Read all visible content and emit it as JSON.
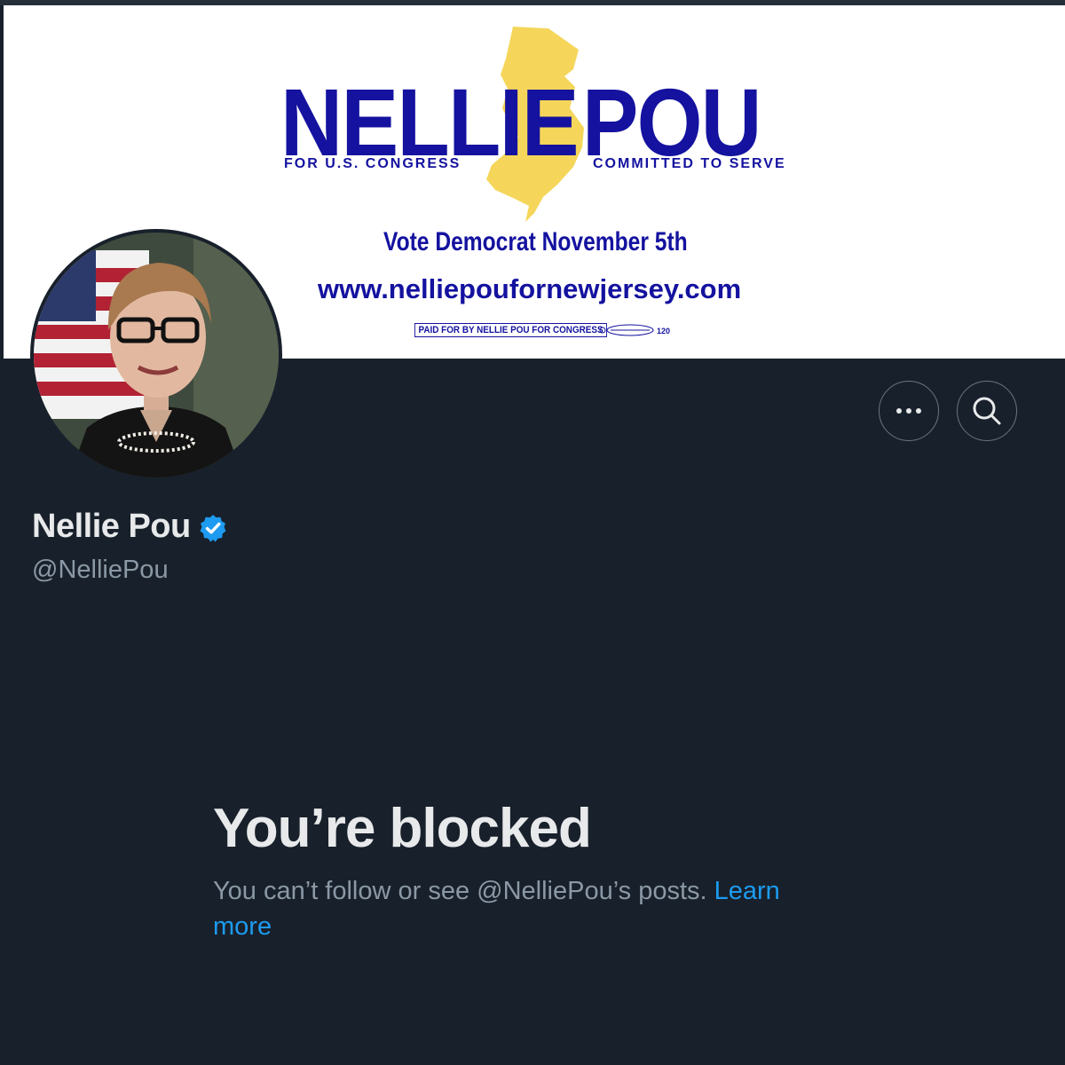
{
  "banner": {
    "name_left": "NELLIE",
    "name_right": "POU",
    "tagline_left": "FOR U.S. CONGRESS",
    "tagline_right": "COMMITTED TO SERVE",
    "vote_line": "Vote Democrat November 5th",
    "website": "www.nelliepoufornewjersey.com",
    "paid_for": "PAID FOR BY NELLIE POU FOR CONGRESS",
    "union_number": "120"
  },
  "profile": {
    "display_name": "Nellie Pou",
    "handle": "@NelliePou"
  },
  "actions": {
    "more_icon": "more-horizontal-icon",
    "search_icon": "search-icon"
  },
  "blocked": {
    "title": "You’re blocked",
    "message": "You can’t follow or see @NelliePou’s posts. ",
    "link_label": "Learn more"
  },
  "colors": {
    "background": "#18202b",
    "brand_blue": "#14129f",
    "nj_yellow": "#f5d65a",
    "link": "#1d9bf0",
    "verified": "#1d9bf0",
    "primary_text": "#e7e9ea",
    "secondary_text": "#8b98a5"
  }
}
